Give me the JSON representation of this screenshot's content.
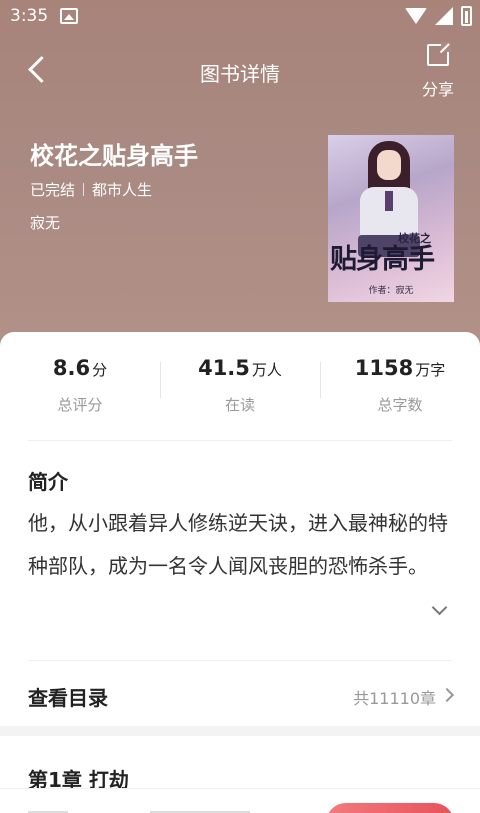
{
  "status_bar": {
    "time": "3:35",
    "icons": [
      "gallery-icon",
      "wifi-icon",
      "signal-icon",
      "battery-icon"
    ]
  },
  "header": {
    "title": "图书详情",
    "share_label": "分享"
  },
  "book": {
    "title": "校花之贴身高手",
    "status": "已完结",
    "category": "都市人生",
    "author": "寂无",
    "cover": {
      "small_title": "校花之",
      "big_title": "贴身高手",
      "author_line": "作者：寂无"
    }
  },
  "stats": [
    {
      "value": "8.6",
      "unit": "分",
      "label": "总评分"
    },
    {
      "value": "41.5",
      "unit": "万人",
      "label": "在读"
    },
    {
      "value": "1158",
      "unit": "万字",
      "label": "总字数"
    }
  ],
  "intro": {
    "title": "简介",
    "text": "他，从小跟着异人修练逆天诀，进入最神秘的特种部队，成为一名令人闻风丧胆的恐怖杀手。"
  },
  "catalog": {
    "title": "查看目录",
    "count": "共11110章"
  },
  "first_chapter": {
    "title": "第1章 打劫"
  },
  "colors": {
    "hero_bg": "#a98a82",
    "accent": "#e8525a"
  }
}
